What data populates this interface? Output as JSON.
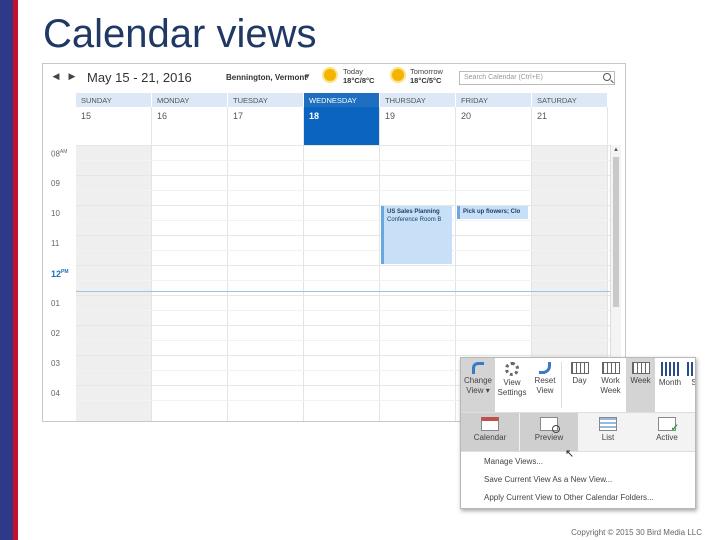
{
  "slide": {
    "title": "Calendar views",
    "copyright": "Copyright © 2015 30 Bird Media LLC"
  },
  "calendar": {
    "date_range": "May 15 - 21, 2016",
    "location": "Bennington, Vermont",
    "weather": [
      {
        "label": "Today",
        "temp": "18°C/8°C",
        "icon": "sun-icon"
      },
      {
        "label": "Tomorrow",
        "temp": "18°C/5°C",
        "icon": "sun-icon"
      }
    ],
    "search_placeholder": "Search Calendar (Ctrl+E)",
    "days": [
      {
        "name": "SUNDAY",
        "num": "15",
        "today": false,
        "weekend": true
      },
      {
        "name": "MONDAY",
        "num": "16",
        "today": false,
        "weekend": false
      },
      {
        "name": "TUESDAY",
        "num": "17",
        "today": false,
        "weekend": false
      },
      {
        "name": "WEDNESDAY",
        "num": "18",
        "today": true,
        "weekend": false
      },
      {
        "name": "THURSDAY",
        "num": "19",
        "today": false,
        "weekend": false
      },
      {
        "name": "FRIDAY",
        "num": "20",
        "today": false,
        "weekend": false
      },
      {
        "name": "SATURDAY",
        "num": "21",
        "today": false,
        "weekend": true
      }
    ],
    "hours": [
      {
        "label": "08",
        "suffix": "AM"
      },
      {
        "label": "09",
        "suffix": ""
      },
      {
        "label": "10",
        "suffix": ""
      },
      {
        "label": "11",
        "suffix": ""
      },
      {
        "label": "12",
        "suffix": "PM"
      },
      {
        "label": "01",
        "suffix": ""
      },
      {
        "label": "02",
        "suffix": ""
      },
      {
        "label": "03",
        "suffix": ""
      },
      {
        "label": "04",
        "suffix": ""
      }
    ],
    "events": [
      {
        "title": "US Sales Planning",
        "location": "Conference Room B",
        "day": "THURSDAY",
        "start": "10:00",
        "end": "12:00"
      },
      {
        "title": "Pick up flowers; Clo",
        "location": "",
        "day": "FRIDAY",
        "start": "10:00",
        "end": "10:30"
      }
    ]
  },
  "ribbon": {
    "buttons": [
      {
        "label1": "Change",
        "label2": "View ▾",
        "icon": "change-view-icon"
      },
      {
        "label1": "View",
        "label2": "Settings",
        "icon": "gear-icon"
      },
      {
        "label1": "Reset",
        "label2": "View",
        "icon": "reset-icon"
      },
      {
        "label1": "Day",
        "label2": "",
        "icon": "day-icon"
      },
      {
        "label1": "Work",
        "label2": "Week",
        "icon": "work-week-icon"
      },
      {
        "label1": "Week",
        "label2": "",
        "icon": "week-icon"
      },
      {
        "label1": "Month",
        "label2": "",
        "icon": "month-icon"
      },
      {
        "label1": "Sc",
        "label2": "",
        "icon": "schedule-icon"
      }
    ],
    "gallery": [
      {
        "label": "Calendar",
        "icon": "calendar-view-icon"
      },
      {
        "label": "Preview",
        "icon": "preview-view-icon"
      },
      {
        "label": "List",
        "icon": "list-view-icon"
      },
      {
        "label": "Active",
        "icon": "active-view-icon"
      }
    ],
    "menu": [
      "Manage Views...",
      "Save Current View As a New View...",
      "Apply Current View to Other Calendar Folders..."
    ]
  },
  "colors": {
    "accent": "#1e6fc0",
    "title": "#1f3864",
    "navy_bar": "#2e3a87",
    "red_bar": "#c8102e",
    "event": "#c7e0f7"
  }
}
